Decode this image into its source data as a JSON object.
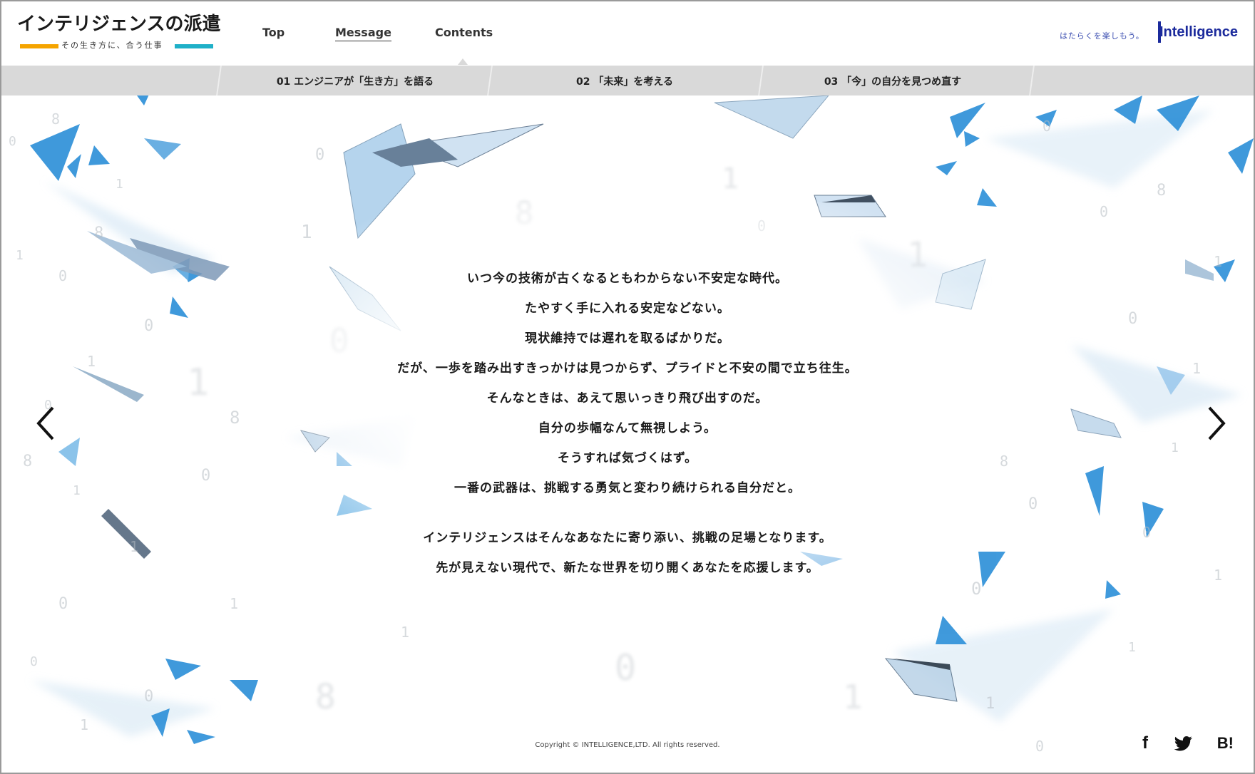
{
  "header": {
    "logo_title": "インテリジェンスの派遣",
    "logo_tagline": "その生き方に、合う仕事",
    "nav": [
      {
        "label": "Top",
        "active": false
      },
      {
        "label": "Message",
        "active": true
      },
      {
        "label": "Contents",
        "active": false
      }
    ],
    "brand_tagline": "はたらくを楽しもう。",
    "brand_logo": "Intelligence"
  },
  "subnav": [
    {
      "label": "01 エンジニアが「生き方」を語る"
    },
    {
      "label": "02 「未来」を考える"
    },
    {
      "label": "03 「今」の自分を見つめ直す"
    }
  ],
  "message": {
    "paragraph1": [
      "いつ今の技術が古くなるともわからない不安定な時代。",
      "たやすく手に入れる安定などない。",
      "現状維持では遅れを取るばかりだ。",
      "だが、一歩を踏み出すきっかけは見つからず、プライドと不安の間で立ち往生。",
      "そんなときは、あえて思いっきり飛び出すのだ。",
      "自分の歩幅なんて無視しよう。",
      "そうすれば気づくはず。",
      "一番の武器は、挑戦する勇気と変わり続けられる自分だと。"
    ],
    "paragraph2": [
      "インテリジェンスはそんなあなたに寄り添い、挑戦の足場となります。",
      "先が見えない現代で、新たな世界を切り開くあなたを応援します。"
    ]
  },
  "footer": {
    "copyright": "Copyright © INTELLIGENCE,LTD. All rights reserved.",
    "social": {
      "facebook": "f",
      "hatena": "B!"
    }
  },
  "icons": {
    "prev": "chevron-left-icon",
    "next": "chevron-right-icon",
    "twitter": "twitter-icon"
  },
  "colors": {
    "accent_orange": "#f5a400",
    "accent_cyan": "#1fb0c8",
    "brand_blue": "#1b2a9c",
    "shard_blue": "#2b8fd8",
    "subnav_bg": "#d9d9d9"
  }
}
